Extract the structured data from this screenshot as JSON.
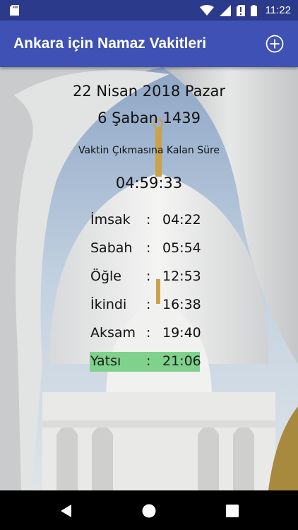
{
  "status_bar": {
    "time": "11:22",
    "icons": [
      "sd-card-icon",
      "wifi-icon",
      "cellular-signal-icon",
      "no-sim-icon",
      "battery-icon"
    ]
  },
  "app_bar": {
    "title": "Ankara için Namaz Vakitleri",
    "action_icon": "add-circle-icon"
  },
  "header": {
    "gregorian_date": "22 Nisan 2018 Pazar",
    "hijri_date": "6 Şaban 1439",
    "remaining_label": "Vaktin Çıkmasına Kalan Süre",
    "remaining_time": "04:59:33"
  },
  "prayer_times": [
    {
      "name": "İmsak",
      "separator": ":",
      "time": "04:22",
      "active": false
    },
    {
      "name": "Sabah",
      "separator": ":",
      "time": "05:54",
      "active": false
    },
    {
      "name": "Öğle",
      "separator": ":",
      "time": "12:53",
      "active": false
    },
    {
      "name": "İkindi",
      "separator": ":",
      "time": "16:38",
      "active": false
    },
    {
      "name": "Aksam",
      "separator": ":",
      "time": "19:40",
      "active": false
    },
    {
      "name": "Yatsı",
      "separator": ":",
      "time": "21:06",
      "active": true
    }
  ],
  "nav_bar": {
    "icons": [
      "back-icon",
      "home-icon",
      "recents-icon"
    ]
  },
  "colors": {
    "status_bar": "#2c3a8c",
    "app_bar": "#3f51b5",
    "highlight": "#7fd18c"
  }
}
